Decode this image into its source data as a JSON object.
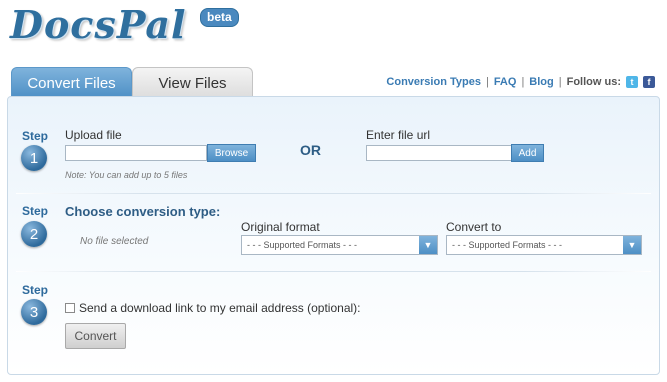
{
  "brand": {
    "name": "DocsPal",
    "badge": "beta"
  },
  "tabs": [
    {
      "label": "Convert Files",
      "active": true
    },
    {
      "label": "View Files",
      "active": false
    }
  ],
  "toplinks": {
    "conversion_types": "Conversion Types",
    "faq": "FAQ",
    "blog": "Blog",
    "follow_label": "Follow us:",
    "sep": "|"
  },
  "steps": [
    {
      "word": "Step",
      "number": "1"
    },
    {
      "word": "Step",
      "number": "2"
    },
    {
      "word": "Step",
      "number": "3"
    }
  ],
  "upload": {
    "label": "Upload file",
    "browse_label": "Browse",
    "note": "Note: You can add up to 5 files",
    "or": "OR",
    "url_label": "Enter file url",
    "add_label": "Add"
  },
  "conversion": {
    "heading": "Choose conversion type:",
    "no_file": "No file selected",
    "original_label": "Original format",
    "original_value": "- - - Supported Formats - - -",
    "convert_to_label": "Convert to",
    "convert_to_value": "- - - Supported Formats - - -"
  },
  "email": {
    "checkbox_label": "Send a download link to my email address (optional):",
    "checked": false,
    "convert_label": "Convert"
  },
  "colors": {
    "accent": "#4d8fc5",
    "brand": "#2f6f9e",
    "twitter": "#4fb6e8",
    "facebook": "#3b5998"
  }
}
